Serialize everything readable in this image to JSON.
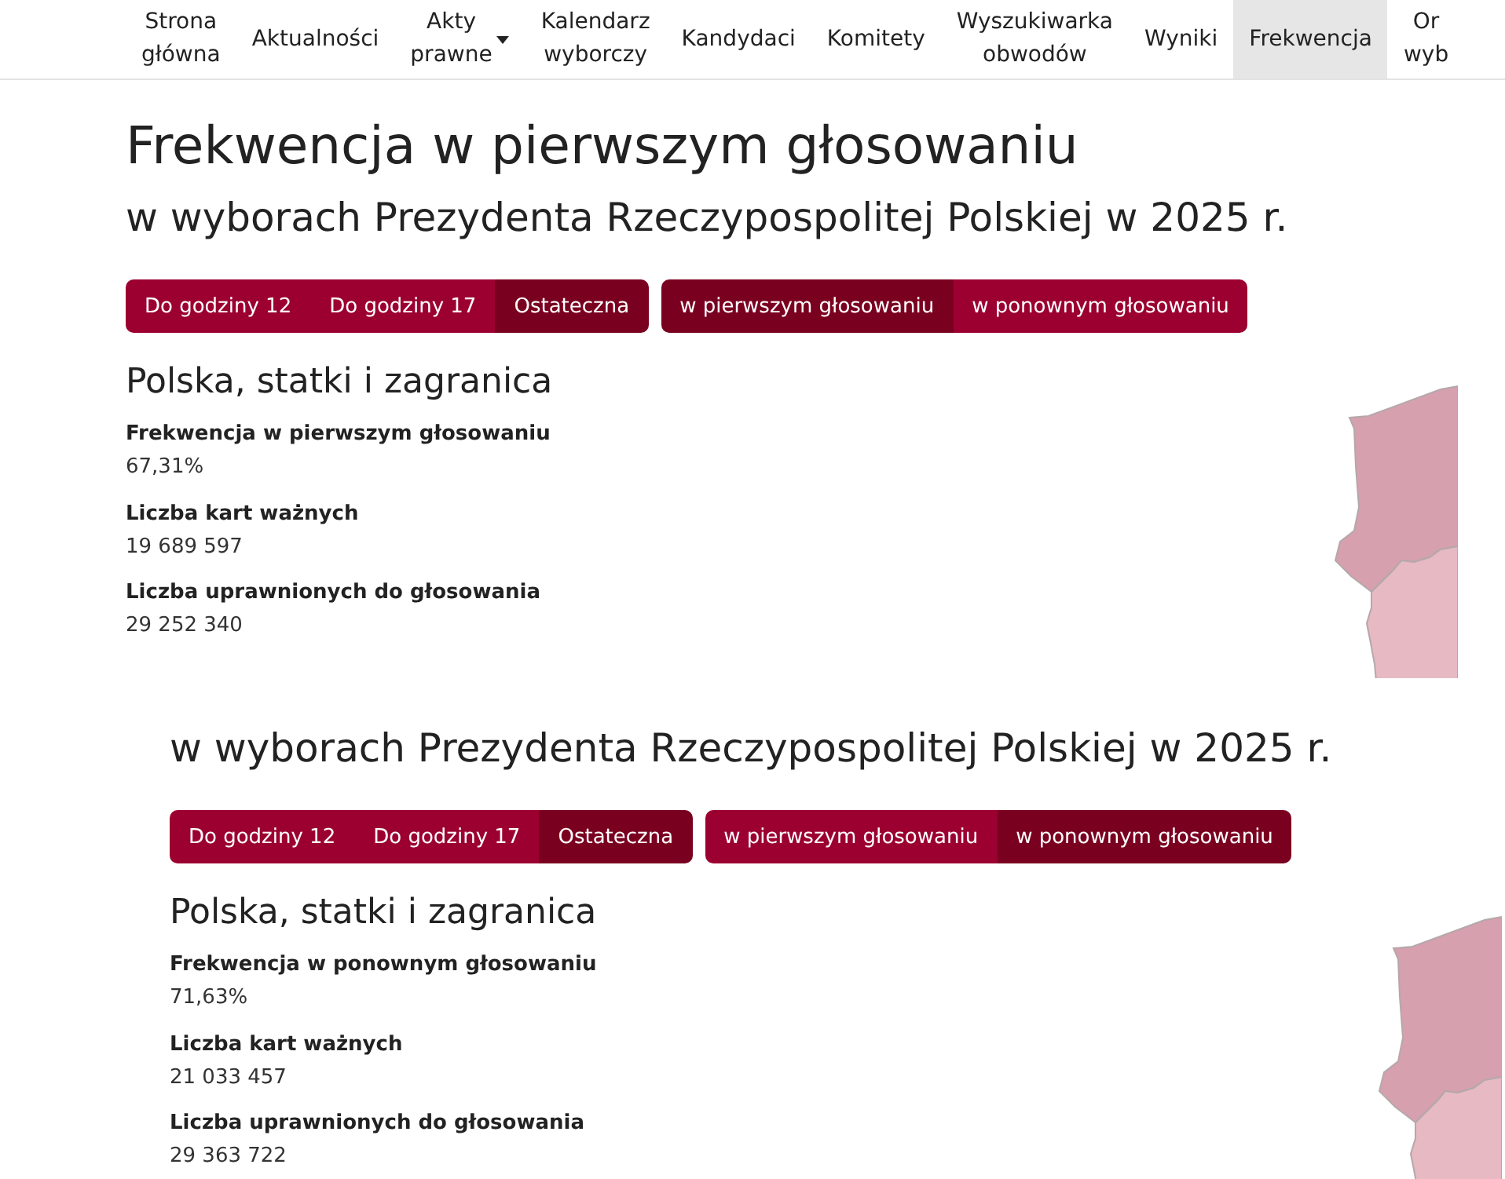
{
  "views": [
    {
      "nav": {
        "items": [
          {
            "label": "Strona główna",
            "selected": false,
            "dropdown": false
          },
          {
            "label": "Aktualności",
            "selected": false,
            "dropdown": false
          },
          {
            "label": "Akty prawne",
            "selected": false,
            "dropdown": true
          },
          {
            "label": "Kalendarz wyborczy",
            "selected": false,
            "dropdown": false
          },
          {
            "label": "Kandydaci",
            "selected": false,
            "dropdown": false
          },
          {
            "label": "Komitety",
            "selected": false,
            "dropdown": false
          },
          {
            "label": "Wyszukiwarka obwodów",
            "selected": false,
            "dropdown": false
          },
          {
            "label": "Wyniki",
            "selected": false,
            "dropdown": false
          },
          {
            "label": "Frekwencja",
            "selected": true,
            "dropdown": false
          },
          {
            "label": "Or wyb",
            "selected": false,
            "dropdown": false
          }
        ]
      },
      "title": "Frekwencja w pierwszym głosowaniu",
      "subtitle": "w wyborach Prezydenta Rzeczypospolitej Polskiej w 2025 r.",
      "time_filters": [
        {
          "label": "Do godziny 12",
          "selected": false
        },
        {
          "label": "Do godziny 17",
          "selected": false
        },
        {
          "label": "Ostateczna",
          "selected": true
        }
      ],
      "round_filters": [
        {
          "label": "w pierwszym głosowaniu",
          "selected": true
        },
        {
          "label": "w ponownym głosowaniu",
          "selected": false
        }
      ],
      "region": {
        "name": "Polska, statki i zagranica",
        "stats": [
          {
            "label": "Frekwencja w pierwszym głosowaniu",
            "value": "67,31%"
          },
          {
            "label": "Liczba kart ważnych",
            "value": "19 689 597"
          },
          {
            "label": "Liczba uprawnionych do głosowania",
            "value": "29 252 340"
          }
        ]
      }
    },
    {
      "subtitle": "w wyborach Prezydenta Rzeczypospolitej Polskiej w 2025 r.",
      "time_filters": [
        {
          "label": "Do godziny 12",
          "selected": false
        },
        {
          "label": "Do godziny 17",
          "selected": false
        },
        {
          "label": "Ostateczna",
          "selected": true
        }
      ],
      "round_filters": [
        {
          "label": "w pierwszym głosowaniu",
          "selected": false
        },
        {
          "label": "w ponownym głosowaniu",
          "selected": true
        }
      ],
      "region": {
        "name": "Polska, statki i zagranica",
        "stats": [
          {
            "label": "Frekwencja w ponownym głosowaniu",
            "value": "71,63%"
          },
          {
            "label": "Liczba kart ważnych",
            "value": "21 033 457"
          },
          {
            "label": "Liczba uprawnionych do głosowania",
            "value": "29 363 722"
          }
        ]
      }
    }
  ]
}
